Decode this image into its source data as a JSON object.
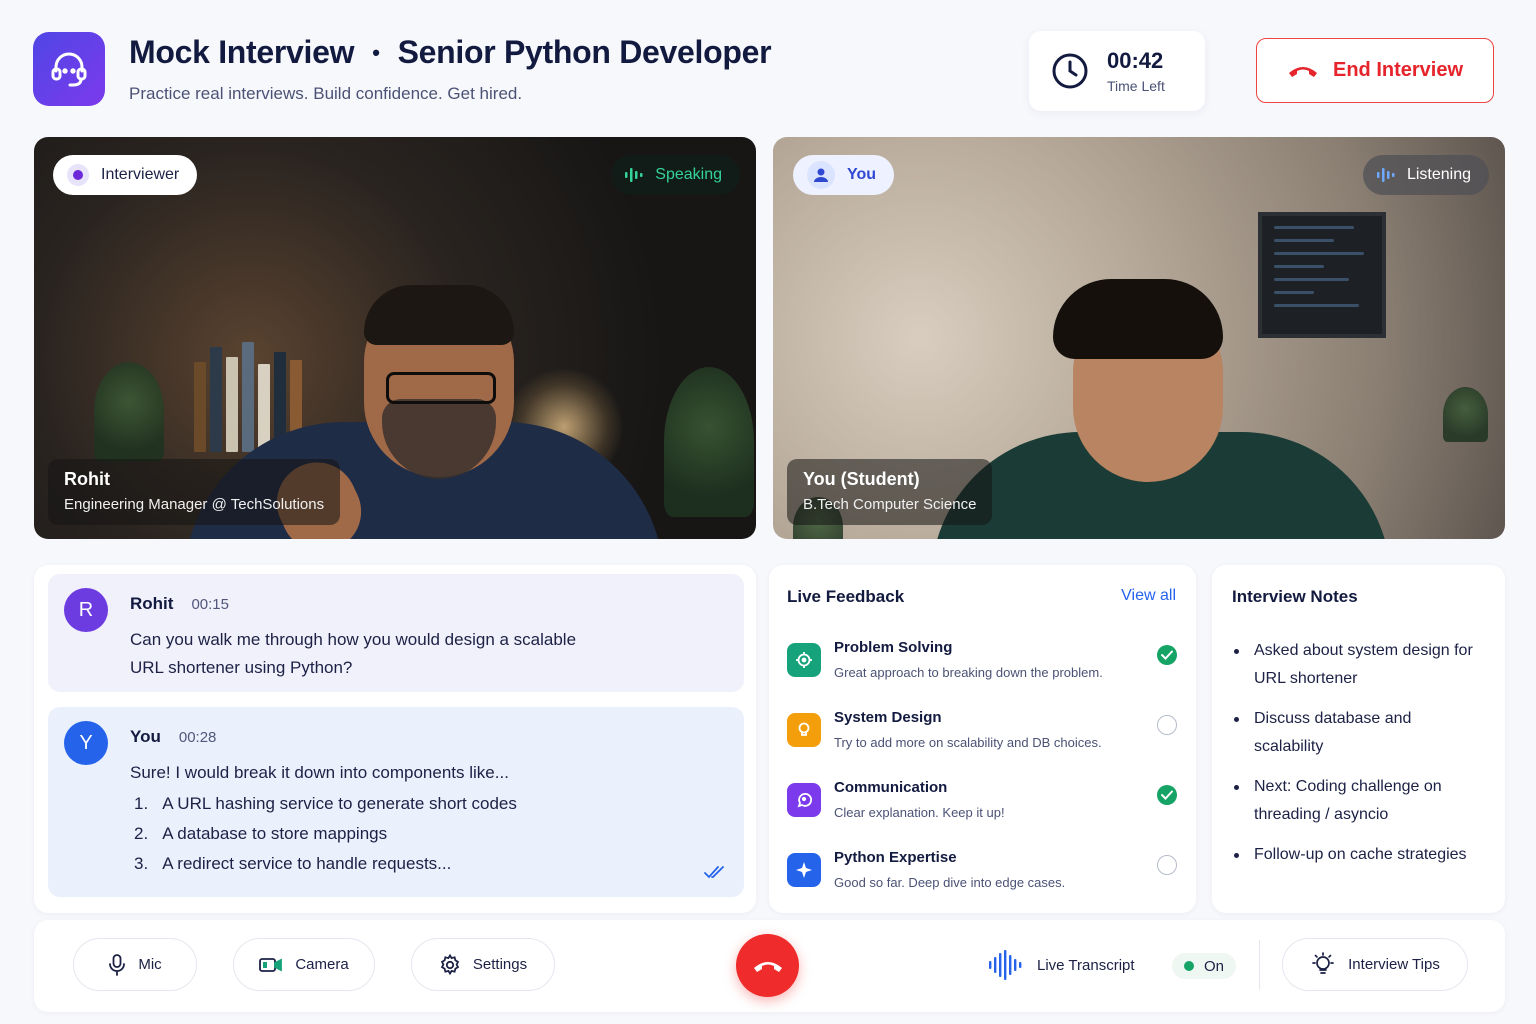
{
  "header": {
    "title": "Mock Interview",
    "role": "Senior Python Developer",
    "subtitle": "Practice real interviews. Build confidence. Get hired.",
    "timer_value": "00:42",
    "timer_label": "Time Left",
    "end_button": "End Interview",
    "logo_icon": "headset-icon"
  },
  "interviewer_tile": {
    "tag": "Interviewer",
    "status": "Speaking",
    "name": "Rohit",
    "role": "Engineering Manager @ TechSolutions"
  },
  "student_tile": {
    "tag": "You",
    "status": "Listening",
    "name": "You (Student)",
    "role": "B.Tech Computer Science"
  },
  "chat": {
    "messages": [
      {
        "avatar": "R",
        "sender": "Rohit",
        "time": "00:15",
        "text": "Can you walk me through how you would design a scalable URL shortener using Python?"
      },
      {
        "avatar": "Y",
        "sender": "You",
        "time": "00:28",
        "text": "Sure! I would break it down into components like...",
        "list": [
          {
            "num": "1.",
            "text": "A URL hashing service to generate short codes"
          },
          {
            "num": "2.",
            "text": "A database to store mappings"
          },
          {
            "num": "3.",
            "text": "A redirect service to handle requests..."
          }
        ]
      }
    ]
  },
  "feedback": {
    "title": "Live Feedback",
    "view_all": "View all",
    "items": [
      {
        "title": "Problem Solving",
        "desc": "Great approach to breaking down the problem.",
        "icon": "target-icon",
        "color": "#16a37b",
        "done": true
      },
      {
        "title": "System Design",
        "desc": "Try to add more on scalability and DB choices.",
        "icon": "lightbulb-icon",
        "color": "#f59e0b",
        "done": false
      },
      {
        "title": "Communication",
        "desc": "Clear explanation. Keep it up!",
        "icon": "chat-icon",
        "color": "#7c3aed",
        "done": true
      },
      {
        "title": "Python Expertise",
        "desc": "Good so far. Deep dive into edge cases.",
        "icon": "sparkle-icon",
        "color": "#2563eb",
        "done": false
      }
    ]
  },
  "notes": {
    "title": "Interview Notes",
    "items": [
      "Asked about system design for URL shortener",
      "Discuss database and scalability",
      "Next: Coding challenge on threading / asyncio",
      "Follow-up on cache strategies"
    ]
  },
  "controls": {
    "mic": "Mic",
    "camera": "Camera",
    "settings": "Settings",
    "transcript": "Live Transcript",
    "transcript_state": "On",
    "tips": "Interview Tips"
  },
  "colors": {
    "accent": "#4f46e5",
    "danger": "#ef2b2b",
    "success": "#16a366",
    "link": "#2563eb"
  }
}
